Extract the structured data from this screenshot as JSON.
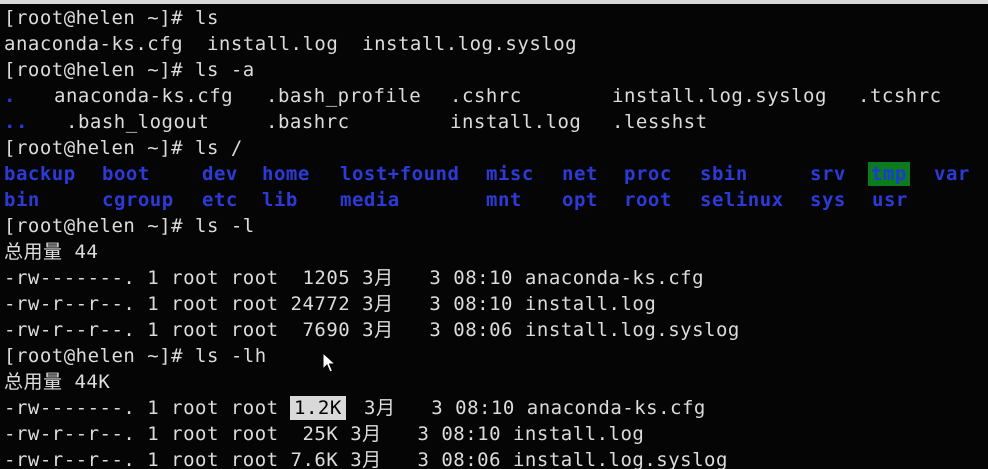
{
  "terminal": {
    "line1": "[root@helen ~]# ls",
    "line2": "anaconda-ks.cfg  install.log  install.log.syslog",
    "line3": "[root@helen ~]# ls -a",
    "la": {
      "dot": ".",
      "anaconda": "anaconda-ks.cfg",
      "bash_profile": ".bash_profile",
      "cshrc": ".cshrc",
      "syslog": "install.log.syslog",
      "tcshrc": ".tcshrc",
      "dotdot": "..",
      "bash_logout": ".bash_logout",
      "bashrc": ".bashrc",
      "installlog": "install.log",
      "lesshst": ".lesshst"
    },
    "line6": "[root@helen ~]# ls /",
    "root_dirs_row1": [
      "backup",
      "boot",
      "dev",
      "home",
      "lost+found",
      "misc",
      "net",
      "proc",
      "sbin",
      "srv",
      "tmp",
      "var"
    ],
    "root_dirs_row2": [
      "bin",
      "cgroup",
      "etc",
      "lib",
      "media",
      "mnt",
      "opt",
      "root",
      "selinux",
      "sys",
      "usr"
    ],
    "line9": "[root@helen ~]# ls -l",
    "line10": "总用量 44",
    "line11": "-rw-------. 1 root root  1205 3月   3 08:10 anaconda-ks.cfg",
    "line12": "-rw-r--r--. 1 root root 24772 3月   3 08:10 install.log",
    "line13": "-rw-r--r--. 1 root root  7690 3月   3 08:06 install.log.syslog",
    "line14": "[root@helen ~]# ls -lh",
    "line15": "总用量 44K",
    "line16_pre": "-rw-------. 1 root root",
    "line16_sel": "1.2K",
    "line16_post": "3月   3 08:10 anaconda-ks.cfg",
    "line17": "-rw-r--r--. 1 root root  25K 3月   3 08:10 install.log",
    "line18": "-rw-r--r--. 1 root root 7.6K 3月   3 08:06 install.log.syslog"
  },
  "colors": {
    "background": "#050505",
    "text": "#dcdcdc",
    "directory": "#2c3bd8",
    "tmp_highlight": "#0c7a1e",
    "selection": "#d9d9d9"
  }
}
